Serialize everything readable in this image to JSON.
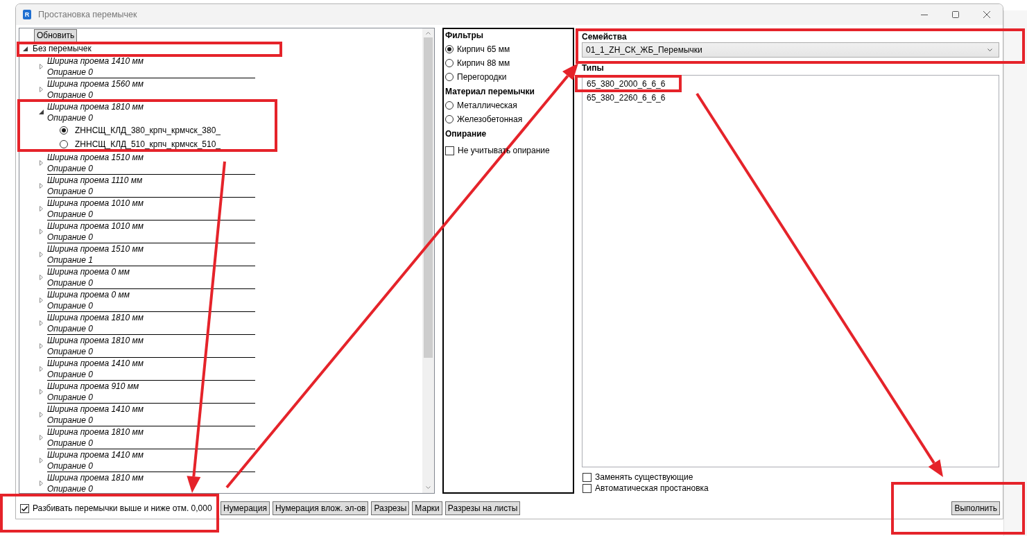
{
  "window": {
    "icon_letter": "R",
    "title": "Простановка перемычек"
  },
  "tree": {
    "refresh_button": "Обновить",
    "items": [
      {
        "label": "Без перемычек",
        "expanded": true,
        "children": [
          {
            "width": "Ширина проема 1410 мм",
            "support": "Опирание 0",
            "expanded": false
          },
          {
            "width": "Ширина проема 1560 мм",
            "support": "Опирание 0",
            "expanded": false
          },
          {
            "width": "Ширина проема 1810 мм",
            "support": "Опирание 0",
            "expanded": true,
            "options": [
              {
                "label": "ZHНСЩ_КЛД_380_крпч_крмчск_380_",
                "selected": true
              },
              {
                "label": "ZHНСЩ_КЛД_510_крпч_крмчск_510_",
                "selected": false
              }
            ]
          },
          {
            "width": "Ширина проема 1510 мм",
            "support": "Опирание 0",
            "expanded": false
          },
          {
            "width": "Ширина проема 1110 мм",
            "support": "Опирание 0",
            "expanded": false
          },
          {
            "width": "Ширина проема 1010 мм",
            "support": "Опирание 0",
            "expanded": false
          },
          {
            "width": "Ширина проема 1010 мм",
            "support": "Опирание 0",
            "expanded": false
          },
          {
            "width": "Ширина проема 1510 мм",
            "support": "Опирание 1",
            "expanded": false
          },
          {
            "width": "Ширина проема 0 мм",
            "support": "Опирание 0",
            "expanded": false
          },
          {
            "width": "Ширина проема 0 мм",
            "support": "Опирание 0",
            "expanded": false
          },
          {
            "width": "Ширина проема 1810 мм",
            "support": "Опирание 0",
            "expanded": false
          },
          {
            "width": "Ширина проема 1810 мм",
            "support": "Опирание 0",
            "expanded": false
          },
          {
            "width": "Ширина проема 1410 мм",
            "support": "Опирание 0",
            "expanded": false
          },
          {
            "width": "Ширина проема 910 мм",
            "support": "Опирание 0",
            "expanded": false
          },
          {
            "width": "Ширина проема 1410 мм",
            "support": "Опирание 0",
            "expanded": false
          },
          {
            "width": "Ширина проема 1810 мм",
            "support": "Опирание 0",
            "expanded": false
          },
          {
            "width": "Ширина проема 1410 мм",
            "support": "Опирание 0",
            "expanded": false
          },
          {
            "width": "Ширина проема 1810 мм",
            "support": "Опирание 0",
            "expanded": false
          }
        ]
      }
    ]
  },
  "filters": {
    "sections": [
      {
        "heading": "Фильтры",
        "options": [
          {
            "kind": "radio",
            "label": "Кирпич 65 мм",
            "selected": true
          },
          {
            "kind": "radio",
            "label": "Кирпич 88 мм",
            "selected": false
          },
          {
            "kind": "radio",
            "label": "Перегородки",
            "selected": false
          }
        ]
      },
      {
        "heading": "Материал перемычки",
        "options": [
          {
            "kind": "radio",
            "label": "Металлическая",
            "selected": false
          },
          {
            "kind": "radio",
            "label": "Железобетонная",
            "selected": false
          }
        ]
      },
      {
        "heading": "Опирание",
        "options": [
          {
            "kind": "checkbox",
            "label": "Не учитывать опирание",
            "checked": false
          }
        ]
      }
    ]
  },
  "families": {
    "label": "Семейства",
    "value": "01_1_ZH_СК_ЖБ_Перемычки"
  },
  "types": {
    "label": "Типы",
    "items": [
      {
        "label": "65_380_2000_6_6_6",
        "selected": false
      },
      {
        "label": "65_380_2260_6_6_6",
        "selected": false
      }
    ]
  },
  "options": [
    {
      "label": "Заменять существующие",
      "checked": false
    },
    {
      "label": "Автоматическая простановка",
      "checked": false
    }
  ],
  "split_levels": {
    "label": "Разбивать перемычки выше и ниже отм. 0,000",
    "checked": true
  },
  "toolbar_buttons": [
    "Нумерация",
    "Нумерация влож. эл-ов",
    "Разрезы",
    "Марки",
    "Разрезы на листы"
  ],
  "run_button": "Выполнить",
  "annotations": [
    {
      "kind": "frame"
    },
    {
      "kind": "frame"
    },
    {
      "kind": "frame"
    },
    {
      "kind": "frame"
    },
    {
      "kind": "frame"
    },
    {
      "kind": "frame"
    },
    {
      "kind": "arrow"
    },
    {
      "kind": "arrow"
    },
    {
      "kind": "arrow"
    }
  ]
}
